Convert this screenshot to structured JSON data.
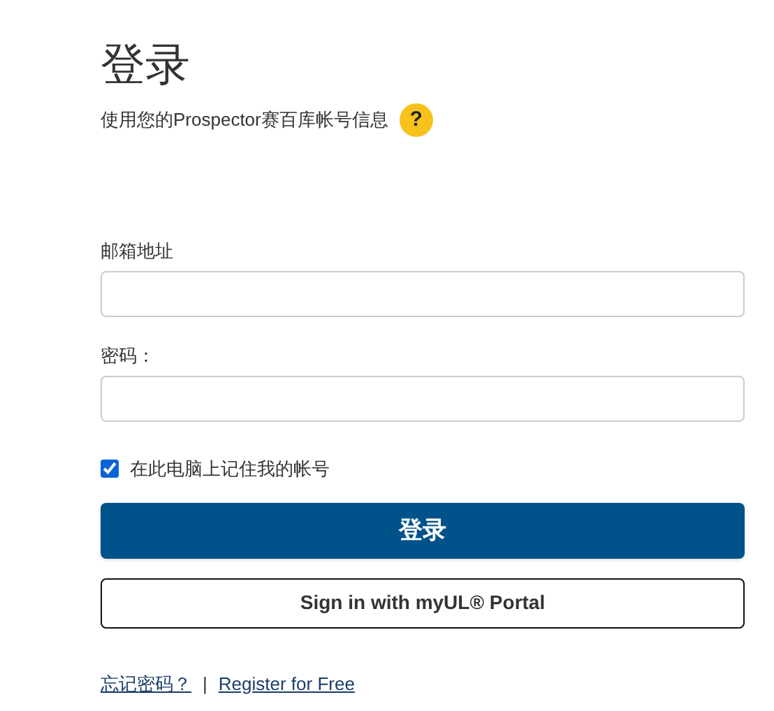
{
  "title": "登录",
  "subtitle": "使用您的Prospector赛百库帐号信息",
  "help_badge": "?",
  "fields": [
    {
      "label": "邮箱地址"
    },
    {
      "label": "密码："
    }
  ],
  "remember": {
    "label": "在此电脑上记住我的帐号",
    "checked": true
  },
  "login_button": "登录",
  "portal_button": "Sign in with myUL® Portal",
  "links": [
    {
      "label": "忘记密码？"
    },
    {
      "label": "Register for Free"
    }
  ],
  "separator": "|"
}
